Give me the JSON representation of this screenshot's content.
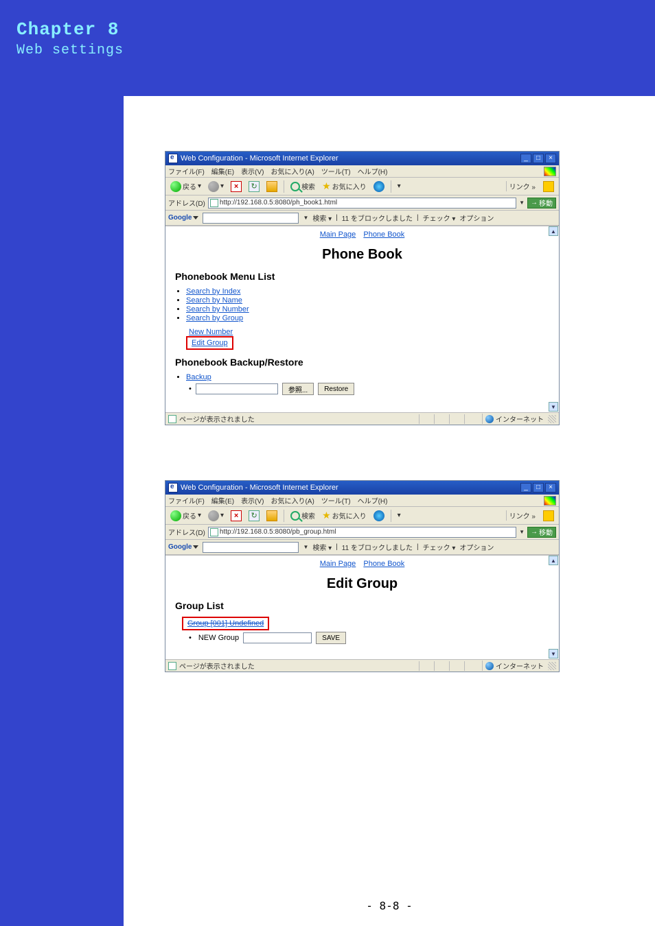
{
  "chapter": {
    "title": "Chapter 8",
    "subtitle": "Web settings"
  },
  "page_number": "- 8-8 -",
  "ie_common": {
    "title": "Web Configuration - Microsoft Internet Explorer",
    "menus": {
      "file": "ファイル(F)",
      "edit": "編集(E)",
      "view": "表示(V)",
      "fav": "お気に入り(A)",
      "tools": "ツール(T)",
      "help": "ヘルプ(H)"
    },
    "toolbar": {
      "back": "戻る",
      "search": "検索",
      "favorites": "お気に入り",
      "links": "リンク"
    },
    "addr_label": "アドレス(D)",
    "go": "移動",
    "google": {
      "label": "Google",
      "search_btn": "検索",
      "blocked": "11 をブロックしました",
      "check": "チェック",
      "options": "オプション"
    },
    "status": "ページが表示されました",
    "net": "インターネット",
    "toplinks": {
      "main": "Main Page",
      "pb": "Phone Book"
    },
    "win_btns": {
      "min": "_",
      "max": "□",
      "close": "×"
    }
  },
  "win1": {
    "url": "http://192.168.0.5:8080/ph_book1.html",
    "h1": "Phone Book",
    "menu_h": "Phonebook Menu List",
    "links": {
      "by_index": "Search by Index",
      "by_name": "Search by Name",
      "by_number": "Search by Number",
      "by_group": "Search by Group",
      "new_number": "New Number",
      "edit_group": "Edit Group"
    },
    "backup_h": "Phonebook Backup/Restore",
    "backup": "Backup",
    "browse_btn": "参照...",
    "restore_btn": "Restore"
  },
  "win2": {
    "url": "http://192.168.0.5:8080/pb_group.html",
    "h1": "Edit Group",
    "list_h": "Group List",
    "group_link": "Group [001] Undefined",
    "new_group_label": "NEW Group",
    "save_btn": "SAVE"
  }
}
